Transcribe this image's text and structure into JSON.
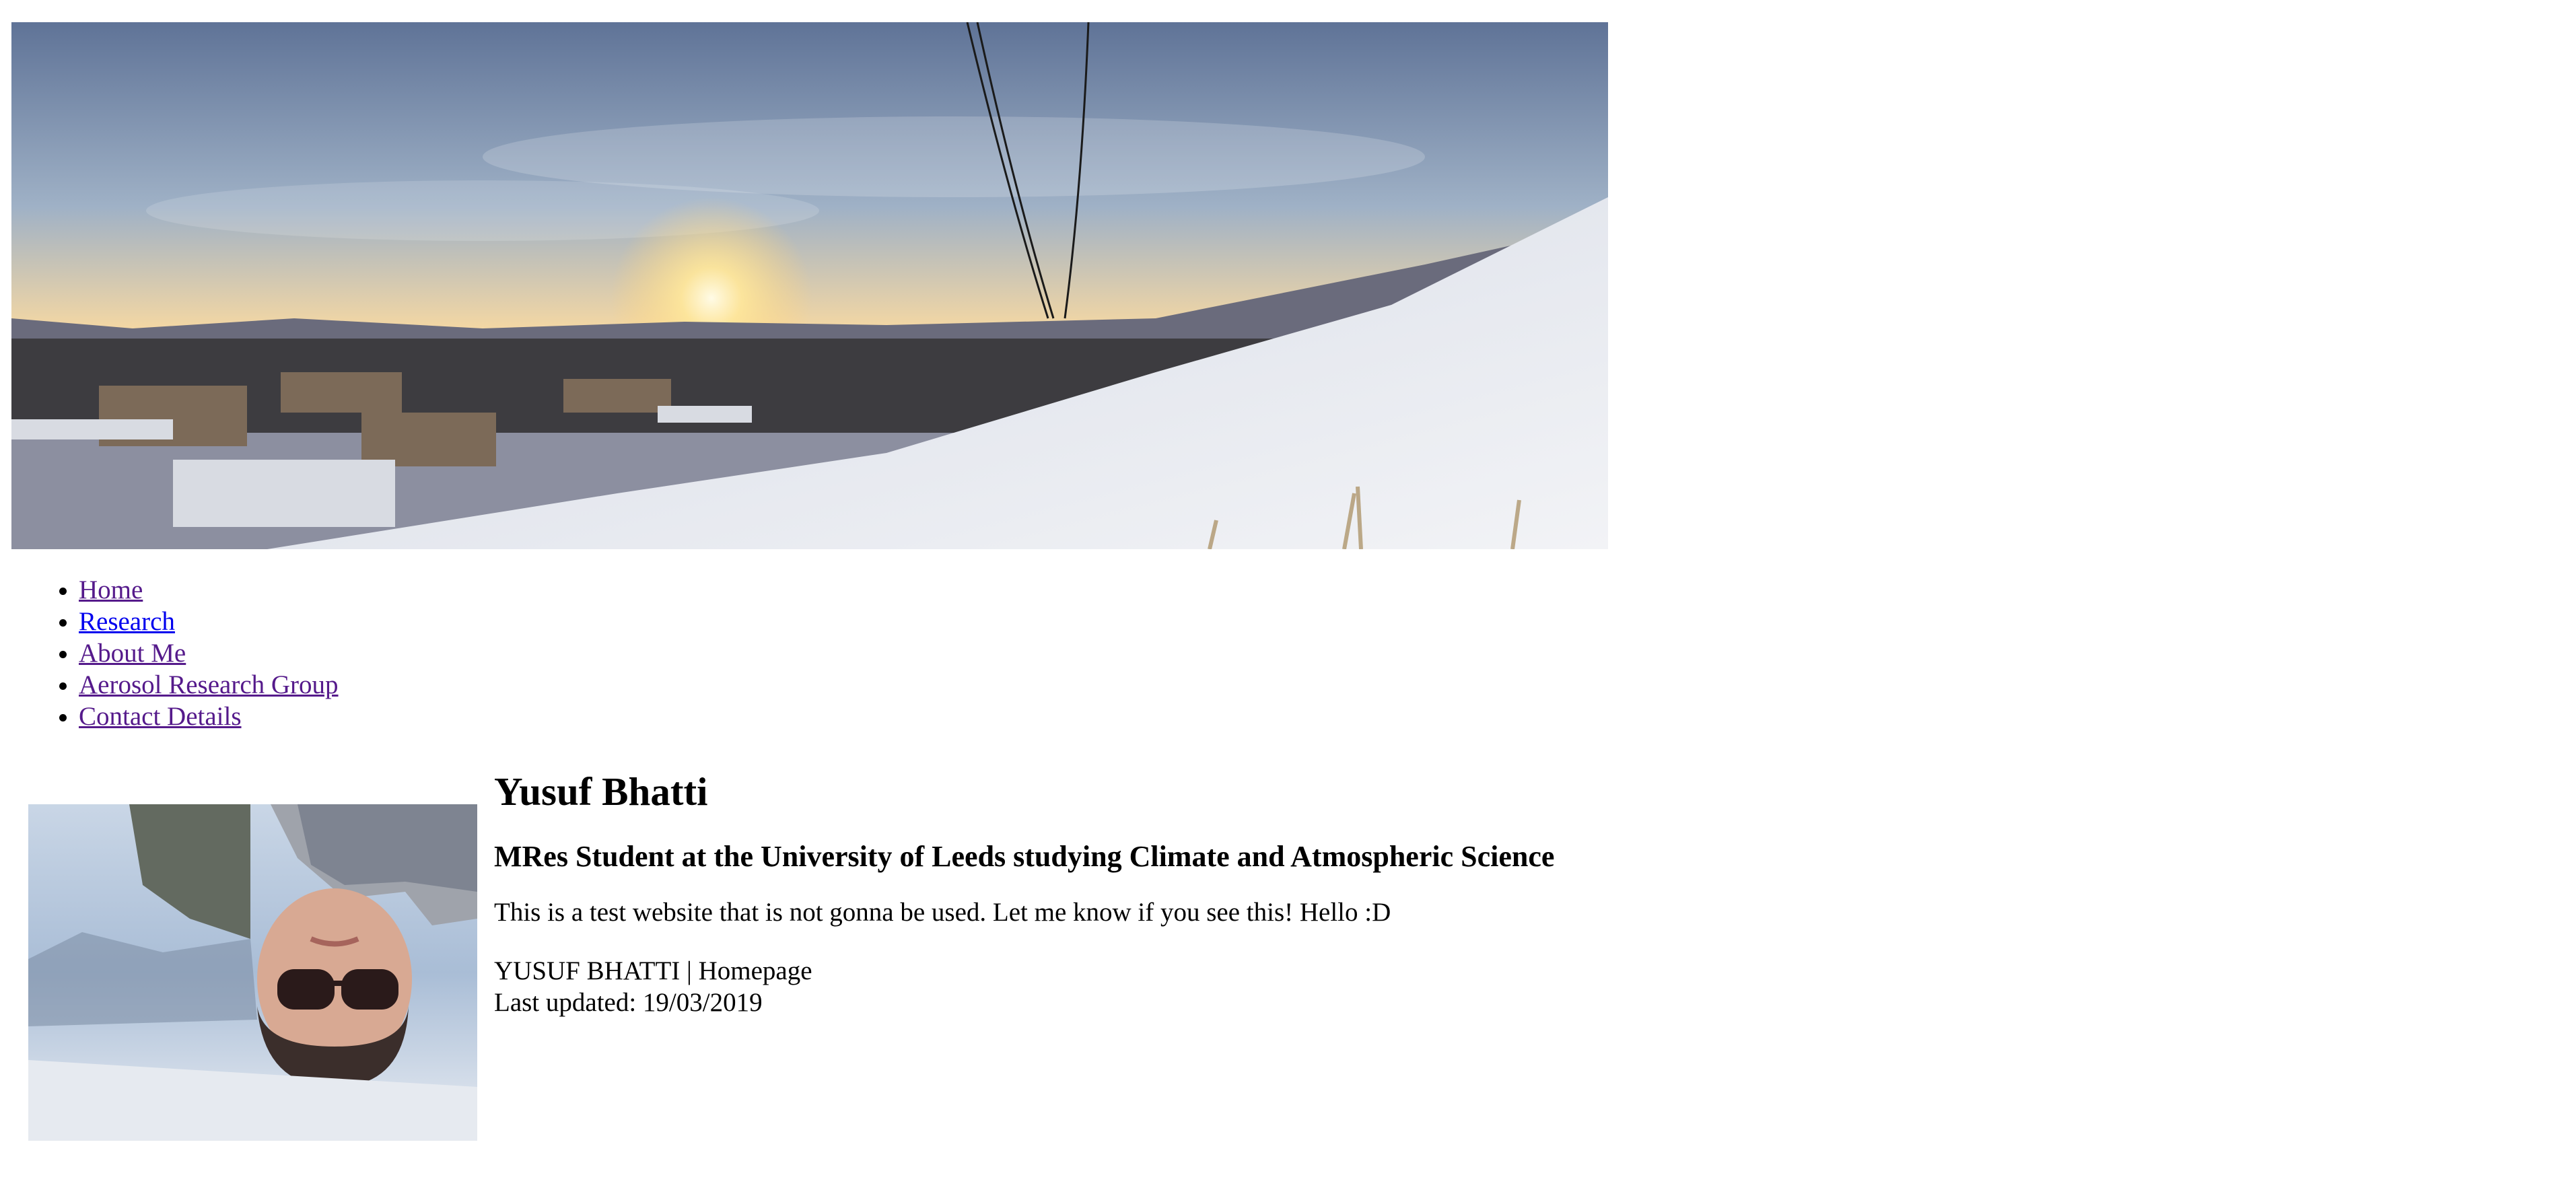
{
  "page": {
    "banner_alt": "Panoramic sunset over a snowy hillside and city",
    "profile_alt": "Upside-down selfie of Yusuf Bhatti"
  },
  "nav": {
    "items": [
      {
        "label": "Home",
        "visited": true
      },
      {
        "label": "Research",
        "visited": false
      },
      {
        "label": "About Me",
        "visited": true
      },
      {
        "label": "Aerosol Research Group",
        "visited": true
      },
      {
        "label": "Contact Details",
        "visited": true
      }
    ]
  },
  "profile": {
    "name": "Yusuf Bhatti",
    "subtitle": "MRes Student at the University of Leeds studying Climate and Atmospheric Science",
    "intro": "This is a test website that is not gonna be used. Let me know if you see this! Hello :D",
    "footer_title": "YUSUF BHATTI | Homepage",
    "last_updated": "Last updated: 19/03/2019"
  },
  "colors": {
    "link_unvisited": "#0000ee",
    "link_visited": "#551a8b",
    "text": "#000000",
    "background": "#ffffff"
  }
}
